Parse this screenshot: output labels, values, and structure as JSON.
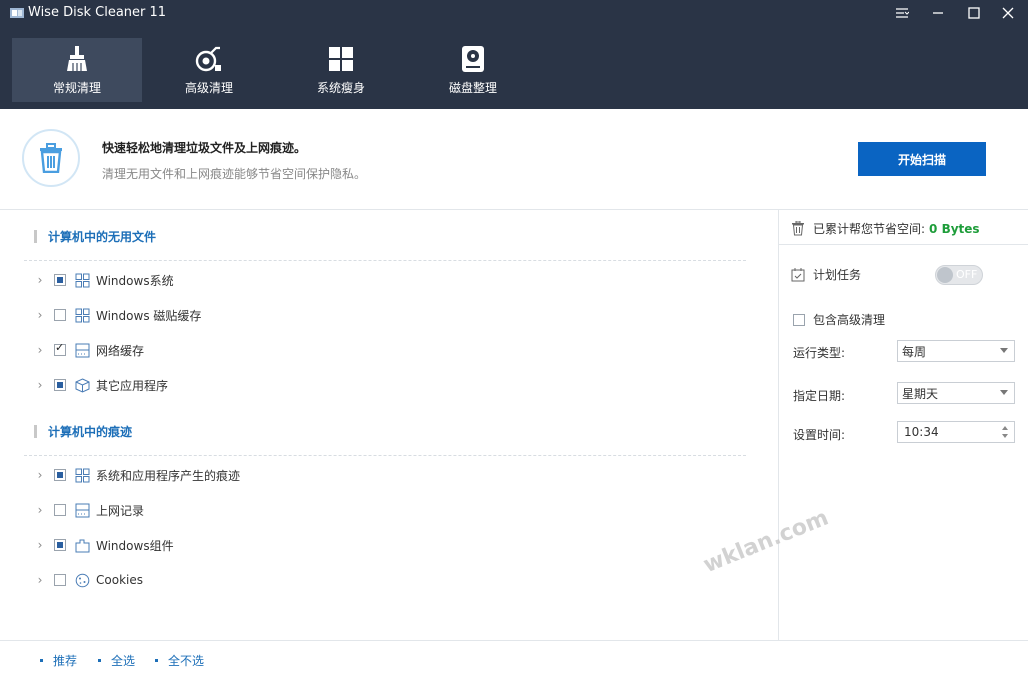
{
  "window": {
    "title": "Wise Disk Cleaner 11"
  },
  "nav": [
    {
      "label": "常规清理",
      "icon": "broom-icon"
    },
    {
      "label": "高级清理",
      "icon": "vacuum-icon"
    },
    {
      "label": "系统瘦身",
      "icon": "windows-icon"
    },
    {
      "label": "磁盘整理",
      "icon": "disk-icon"
    }
  ],
  "info": {
    "title": "快速轻松地清理垃圾文件及上网痕迹。",
    "subtitle": "清理无用文件和上网痕迹能够节省空间保护隐私。",
    "scan_button": "开始扫描"
  },
  "sections": [
    {
      "title": "计算机中的无用文件",
      "items": [
        {
          "label": "Windows系统",
          "state": "partial",
          "icon": "windows-grid-icon"
        },
        {
          "label": "Windows 磁贴缓存",
          "state": "unchecked",
          "icon": "windows-grid-icon"
        },
        {
          "label": "网络缓存",
          "state": "checked",
          "icon": "network-icon"
        },
        {
          "label": "其它应用程序",
          "state": "partial",
          "icon": "package-icon"
        }
      ]
    },
    {
      "title": "计算机中的痕迹",
      "items": [
        {
          "label": "系统和应用程序产生的痕迹",
          "state": "partial",
          "icon": "windows-grid-icon"
        },
        {
          "label": "上网记录",
          "state": "unchecked",
          "icon": "network-icon"
        },
        {
          "label": "Windows组件",
          "state": "partial",
          "icon": "component-icon"
        },
        {
          "label": "Cookies",
          "state": "unchecked",
          "icon": "cookie-icon"
        }
      ]
    }
  ],
  "right": {
    "saved_label": "已累计帮您节省空间:",
    "saved_value": "0 Bytes",
    "schedule_label": "计划任务",
    "toggle_text": "OFF",
    "toggle_on": false,
    "advanced_label": "包含高级清理",
    "run_type_label": "运行类型:",
    "run_type_value": "每周",
    "date_label": "指定日期:",
    "date_value": "星期天",
    "time_label": "设置时间:",
    "time_value": "10:34"
  },
  "footer": {
    "recommend": "推荐",
    "select_all": "全选",
    "select_none": "全不选"
  },
  "watermark": "wklan.com",
  "colors": {
    "topband": "#2a3446",
    "accent": "#0a64c2",
    "saved": "#1e9d3a",
    "link": "#1d6fb8"
  }
}
